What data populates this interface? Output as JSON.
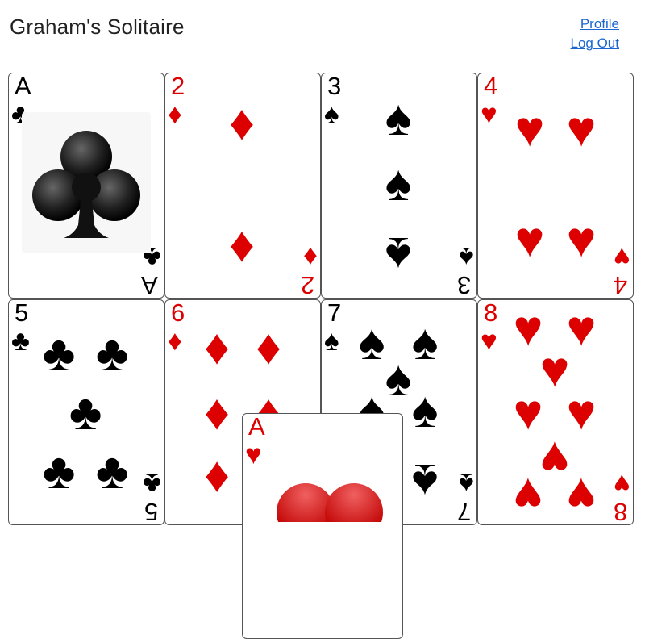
{
  "header": {
    "title": "Graham's Solitaire",
    "profile_link": "Profile",
    "logout_link": "Log Out"
  },
  "colors": {
    "red": "#dd0000",
    "black": "#000000",
    "link": "#1a66d1"
  },
  "cards": [
    {
      "rank": "A",
      "suit": "clubs",
      "symbol": "♣",
      "color": "black"
    },
    {
      "rank": "2",
      "suit": "diamonds",
      "symbol": "♦",
      "color": "red"
    },
    {
      "rank": "3",
      "suit": "spades",
      "symbol": "♠",
      "color": "black"
    },
    {
      "rank": "4",
      "suit": "hearts",
      "symbol": "♥",
      "color": "red"
    },
    {
      "rank": "5",
      "suit": "clubs",
      "symbol": "♣",
      "color": "black"
    },
    {
      "rank": "6",
      "suit": "diamonds",
      "symbol": "♦",
      "color": "red"
    },
    {
      "rank": "7",
      "suit": "spades",
      "symbol": "♠",
      "color": "black"
    },
    {
      "rank": "8",
      "suit": "hearts",
      "symbol": "♥",
      "color": "red"
    }
  ],
  "dragged_card": {
    "rank": "A",
    "suit": "hearts",
    "symbol": "♥",
    "color": "red"
  }
}
